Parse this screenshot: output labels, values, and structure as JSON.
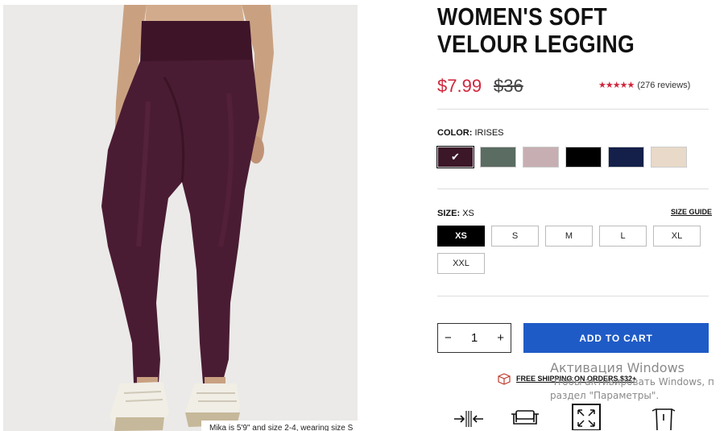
{
  "product": {
    "title": "WOMEN'S SOFT VELOUR LEGGING",
    "sale_price": "$7.99",
    "original_price": "$36",
    "rating_stars": "★★★★★",
    "reviews": "(276 reviews)",
    "image_caption": "Mika is 5'9\" and size 2-4, wearing size S"
  },
  "color": {
    "label": "COLOR:",
    "selected": "IRISES",
    "swatches": [
      {
        "name": "irises",
        "hex": "#3b1728",
        "selected": true
      },
      {
        "name": "green",
        "hex": "#5b6c63",
        "selected": false
      },
      {
        "name": "mauve",
        "hex": "#c7aeb2",
        "selected": false
      },
      {
        "name": "black",
        "hex": "#000000",
        "selected": false
      },
      {
        "name": "navy",
        "hex": "#14204a",
        "selected": false
      },
      {
        "name": "beige",
        "hex": "#e8d9c8",
        "selected": false
      }
    ]
  },
  "size": {
    "label": "SIZE:",
    "selected": "XS",
    "guide_label": "SIZE GUIDE",
    "options": [
      "XS",
      "S",
      "M",
      "L",
      "XL",
      "XXL"
    ]
  },
  "cart": {
    "quantity": "1",
    "minus": "−",
    "plus": "+",
    "add_label": "ADD TO CART"
  },
  "shipping": {
    "text": "FREE SHIPPING ON ORDERS $32+",
    "icon": "box-icon"
  },
  "features": [
    "compression-icon",
    "sofa-icon",
    "stretch-icon",
    "leggings-icon"
  ],
  "watermark": {
    "title": "Активация Windows",
    "line1": "Чтобы активировать Windows, п",
    "line2": "раздел \"Параметры\"."
  },
  "colors": {
    "sale": "#d0263c",
    "accent": "#1f5bc6"
  }
}
